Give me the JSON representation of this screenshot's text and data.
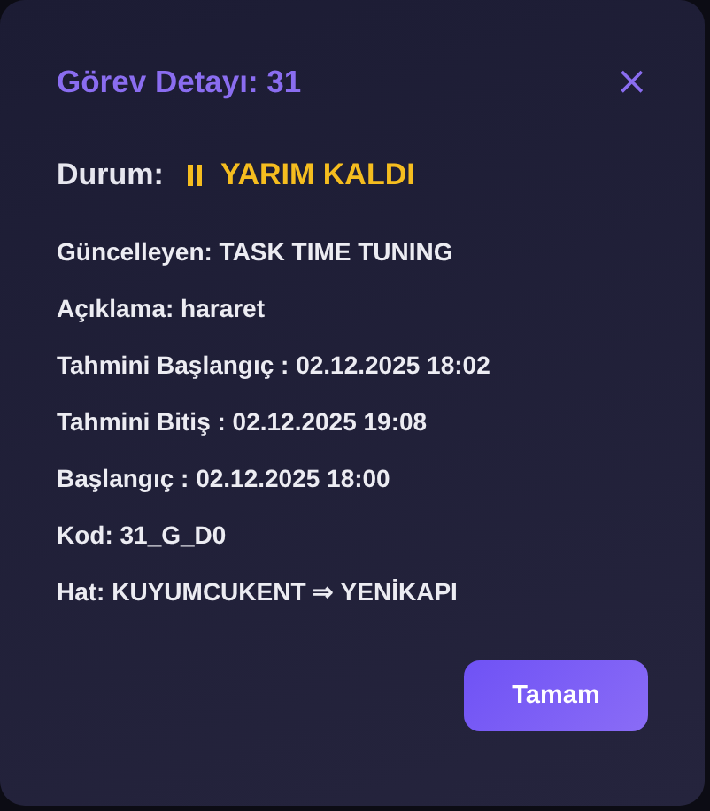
{
  "dialog": {
    "title": "Görev Detayı: 31",
    "close": "×"
  },
  "status": {
    "label": "Durum:",
    "kind": "paused",
    "text": "YARIM KALDI"
  },
  "details": [
    "Güncelleyen: TASK TIME TUNING",
    "Açıklama: hararet",
    "Tahmini Başlangıç : 02.12.2025 18:02",
    "Tahmini Bitiş : 02.12.2025 19:08",
    "Başlangıç : 02.12.2025 18:00",
    "Kod: 31_G_D0",
    "Hat: KUYUMCUKENT ⇒ YENİKAPI"
  ],
  "buttons": [
    "Tamam"
  ]
}
